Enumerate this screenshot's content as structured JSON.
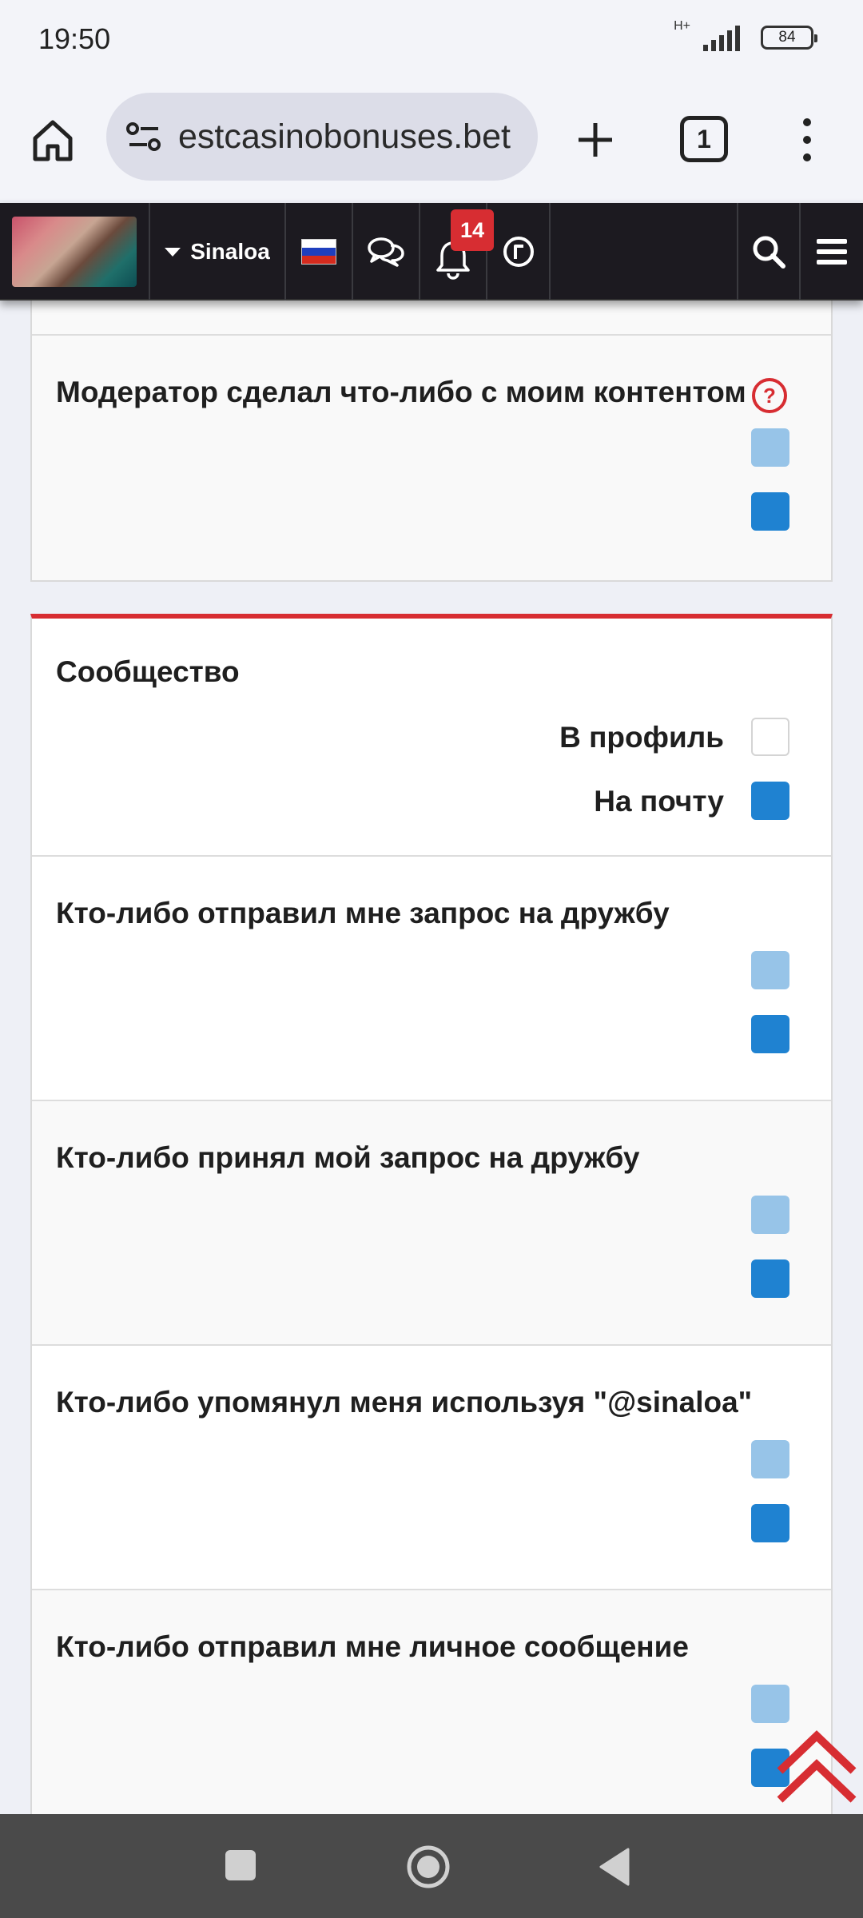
{
  "status_bar": {
    "time": "19:50",
    "network": "H+",
    "battery": "84",
    "icons": [
      "signal-icon",
      "battery-icon"
    ]
  },
  "browser": {
    "url": "estcasinobonuses.bet",
    "tab_count": "1",
    "icons": [
      "home-icon",
      "site-settings-icon",
      "new-tab-icon",
      "tabs-icon",
      "more-icon"
    ]
  },
  "site_nav": {
    "username": "Sinaloa",
    "notification_count": "14",
    "flag_colors": [
      "#ffffff",
      "#1f3fbf",
      "#d52b1e"
    ],
    "icons": [
      "avatar",
      "flag-ru-icon",
      "chat-icon",
      "bell-icon",
      "refresh-icon",
      "search-icon",
      "menu-icon"
    ]
  },
  "panel_top": {
    "row_label": "Модератор сделал что-либо с моим контентом",
    "help_icon": "help-icon"
  },
  "community": {
    "title": "Сообщество",
    "accent_color": "#d72d32",
    "col_profile": "В профиль",
    "col_email": "На почту",
    "rows": [
      {
        "label": "Кто-либо отправил мне запрос на дружбу"
      },
      {
        "label": "Кто-либо принял мой запрос на дружбу"
      },
      {
        "label": "Кто-либо упомянул меня используя \"@sinaloa\""
      },
      {
        "label": "Кто-либо отправил мне личное сообщение"
      }
    ]
  },
  "colors": {
    "checkbox_light": "#97c4e8",
    "checkbox_dark": "#1f82d1",
    "nav_bg": "#1c1a20"
  },
  "system_nav": {
    "icons": [
      "recents-icon",
      "home-circle-icon",
      "back-icon"
    ]
  }
}
